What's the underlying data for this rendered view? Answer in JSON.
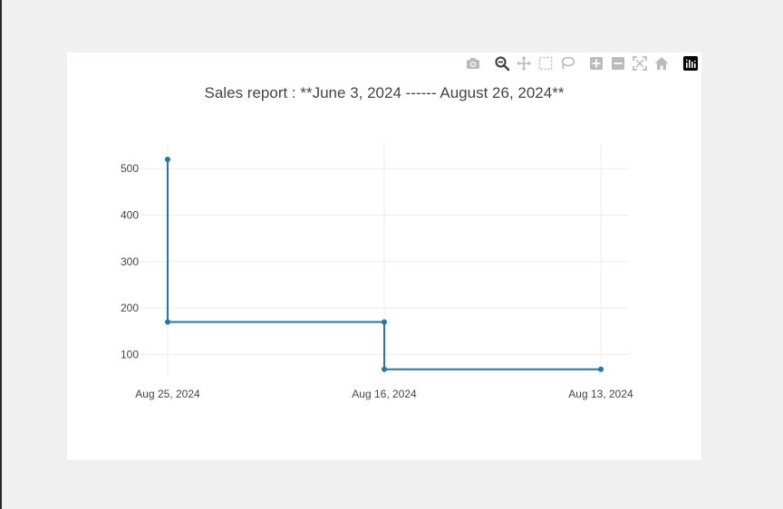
{
  "colors": {
    "series": "#1f77b4",
    "grid": "#eeeeee",
    "text": "#444444",
    "modebar_icon": "#bbbbbb",
    "modebar_active": "#444444"
  },
  "modebar": {
    "buttons": [
      {
        "name": "camera-icon",
        "title": "Download plot as a png"
      },
      {
        "name": "zoom-icon",
        "title": "Zoom"
      },
      {
        "name": "pan-icon",
        "title": "Pan"
      },
      {
        "name": "box-select-icon",
        "title": "Box Select"
      },
      {
        "name": "lasso-select-icon",
        "title": "Lasso Select"
      },
      {
        "name": "zoom-in-icon",
        "title": "Zoom in"
      },
      {
        "name": "zoom-out-icon",
        "title": "Zoom out"
      },
      {
        "name": "autoscale-icon",
        "title": "Autoscale"
      },
      {
        "name": "reset-axes-icon",
        "title": "Reset axes"
      },
      {
        "name": "plotly-logo-icon",
        "title": "Produced with Plotly"
      }
    ]
  },
  "chart_data": {
    "type": "line",
    "line_shape": "hv",
    "title": "Sales report : **June 3, 2024 ------ August 26, 2024**",
    "xlabel": "",
    "ylabel": "",
    "categories": [
      "Aug 25, 2024",
      "Aug 16, 2024",
      "Aug 13, 2024"
    ],
    "series": [
      {
        "values": [
          520,
          170,
          68
        ]
      }
    ],
    "ylim": [
      52,
      555
    ],
    "yticks": [
      100,
      200,
      300,
      400,
      500
    ],
    "grid": true,
    "legend": "none"
  }
}
